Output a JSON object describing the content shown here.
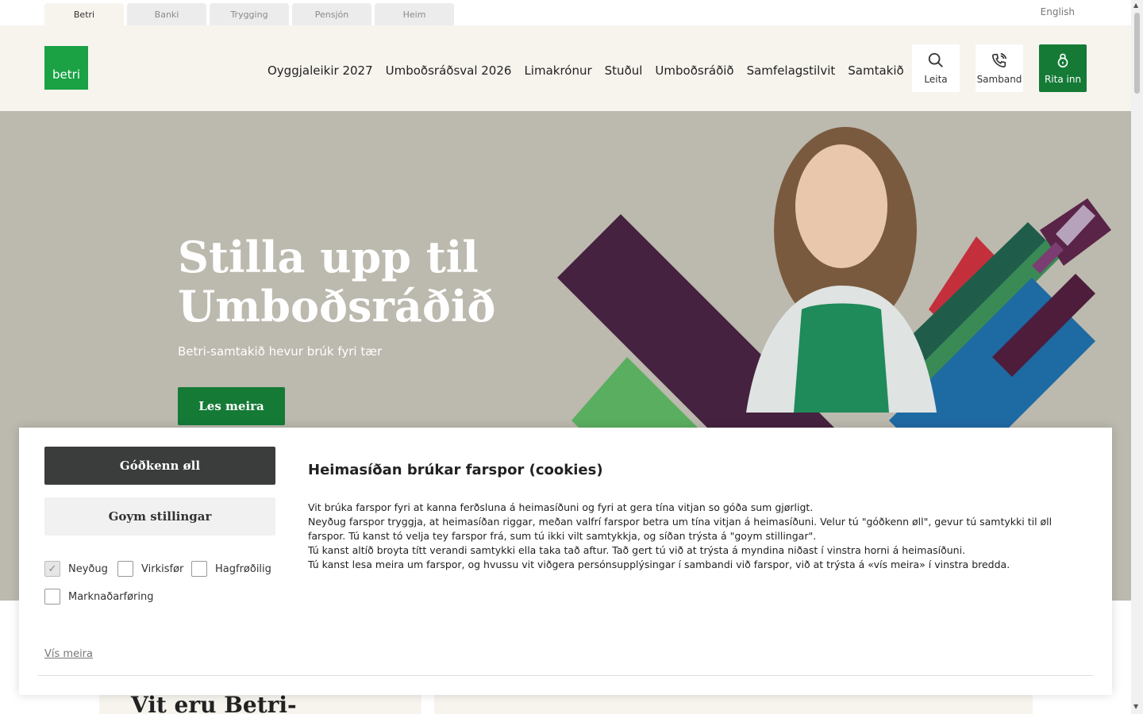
{
  "top_tabs": [
    "Betri",
    "Banki",
    "Trygging",
    "Pensjón",
    "Heim"
  ],
  "language": "English",
  "logo": "betri",
  "nav": [
    "Oyggjaleikir 2027",
    "Umboðsráðsval 2026",
    "Limakrónur",
    "Stuðul",
    "Umboðsráðið",
    "Samfelagstilvit",
    "Samtakið"
  ],
  "header_buttons": {
    "search": "Leita",
    "contact": "Samband",
    "login": "Rita inn"
  },
  "hero": {
    "title": "Stilla upp til Umboðsráðið",
    "subtitle": "Betri-samtakið hevur brúk fyri tær",
    "button": "Les meira"
  },
  "below": {
    "title": "Vit eru Betri-"
  },
  "cookie": {
    "accept_all": "Góðkenn øll",
    "save_settings": "Goym stillingar",
    "checkboxes": [
      {
        "label": "Neyðug",
        "checked": true
      },
      {
        "label": "Virkisfør",
        "checked": false
      },
      {
        "label": "Hagfrøðilig",
        "checked": false
      },
      {
        "label": "Marknaðarføring",
        "checked": false
      }
    ],
    "show_more": "Vís meira",
    "title": "Heimasíðan brúkar farspor (cookies)",
    "paragraphs": [
      "Vit brúka farspor fyri at kanna ferðsluna á heimasíðuni og fyri at gera tína vitjan so góða sum gjørligt.",
      "Neyðug farspor tryggja, at heimasíðan riggar, meðan valfrí farspor betra um tína vitjan á heimasíðuni. Velur tú \"góðkenn øll\", gevur tú samtykki til øll farspor. Tú kanst tó velja tey farspor frá, sum tú ikki vilt samtykkja, og síðan trýsta á \"goym stillingar\".",
      "Tú kanst altíð broyta títt verandi samtykki ella taka tað aftur. Tað gert tú við at trýsta á myndina niðast í vinstra horni á heimasíðuni.",
      "Tú kanst lesa meira um farspor, og hvussu vit viðgera persónsupplýsingar í sambandi við farspor, við at trýsta á «vís meira» í vinstra bredda."
    ]
  },
  "colors": {
    "brand_green": "#147a36",
    "logo_green": "#1aa244",
    "header_bg": "#f7f4ee",
    "hero_bg": "#bcb9ae",
    "dark_button": "#3b3d3c"
  }
}
